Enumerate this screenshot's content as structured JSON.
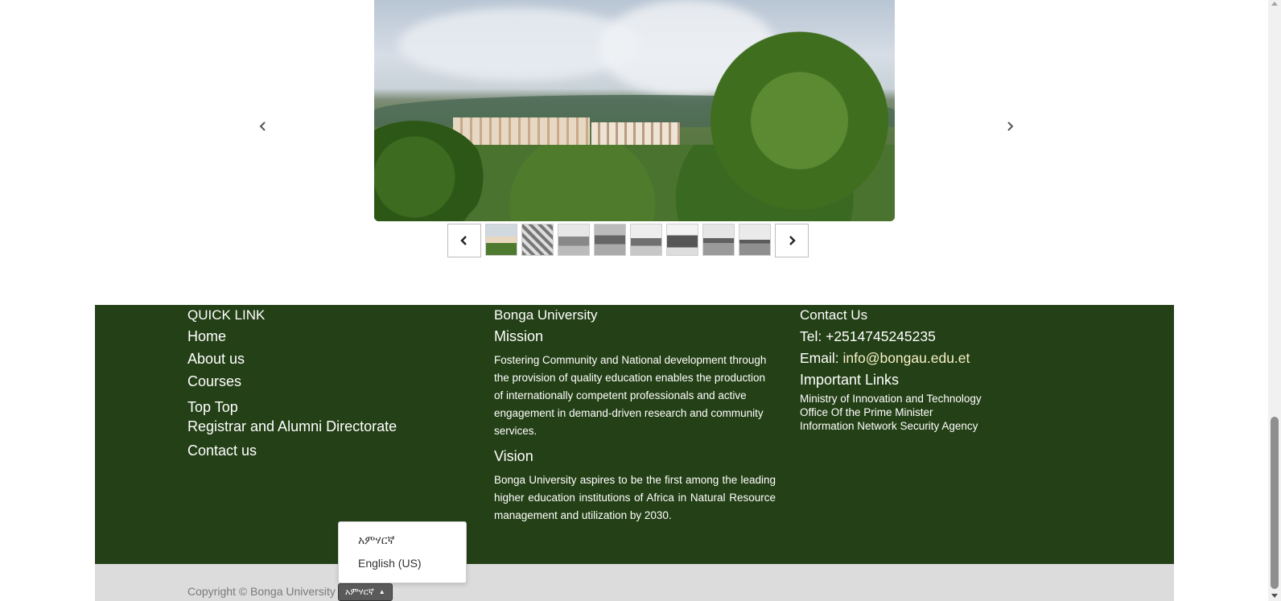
{
  "carousel": {
    "prev_icon": "chevron-left-icon",
    "next_icon": "chevron-right-icon",
    "thumbnail_count": 8
  },
  "footer": {
    "quick_link": {
      "title": "QUICK LINK",
      "items": [
        {
          "label": "Home"
        },
        {
          "label": "About us"
        },
        {
          "label": "Courses"
        },
        {
          "label": "Top Top"
        },
        {
          "label": "Registrar and Alumni Directorate"
        },
        {
          "label": "Contact us"
        }
      ]
    },
    "university": {
      "name": "Bonga University",
      "mission_title": "Mission",
      "mission_text": "Fostering Community and National development through the provision of quality education enables the production of internationally competent professionals and active engagement in demand-driven research and community services.",
      "vision_title": "Vision",
      "vision_text": "Bonga University aspires to be the first among the leading higher education institutions of Africa in Natural Resource management and utilization by 2030."
    },
    "contact": {
      "title": "Contact Us",
      "tel": "Tel: +2514745245235",
      "email_label": "Email: ",
      "email": "info@bongau.edu.et",
      "important_title": "Important Links",
      "links": [
        {
          "label": "Ministry of Innovation and Technology"
        },
        {
          "label": "Office Of the Prime Minister"
        },
        {
          "label": "Information Network Security Agency"
        }
      ]
    }
  },
  "bottom": {
    "copyright": "Copyright © Bonga University"
  },
  "language": {
    "options": [
      {
        "label": "አምሃርኛ"
      },
      {
        "label": "English (US)"
      }
    ],
    "selected": "አምሃርኛ"
  },
  "colors": {
    "footer_bg": "#244016",
    "bottom_bar_bg": "#dcdcdc",
    "email_link": "#f7f0c6"
  }
}
